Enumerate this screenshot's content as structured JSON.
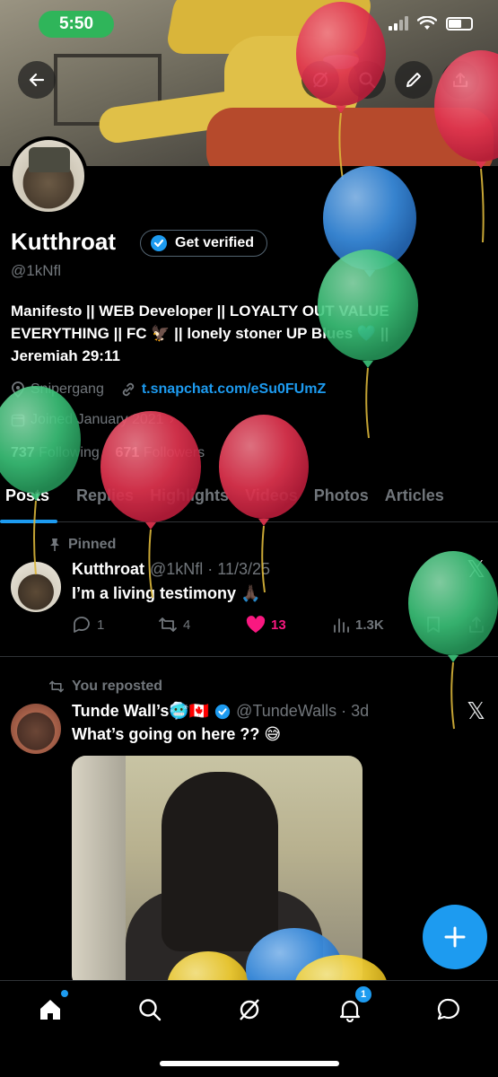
{
  "status_bar": {
    "time": "5:50"
  },
  "profile": {
    "name": "Kutthroat",
    "get_verified_label": "Get verified",
    "handle": "@1kNfl",
    "bio_line1": "Manifesto || WEB Developer || LOYALTY OUT VALUE",
    "bio_line2": "EVERYTHING || FC 🦅 || lonely stoner UP Blues 💙 ||",
    "bio_line3": "Jeremiah 29:11",
    "location": "Snipergang",
    "link": "t.snapchat.com/eSu0FUmZ",
    "joined": "Joined January 2021",
    "following_count": "737",
    "following_label": "Following",
    "followers_count": "671",
    "followers_label": "Followers"
  },
  "tabs": [
    "Posts",
    "Replies",
    "Highlights",
    "Videos",
    "Photos",
    "Articles"
  ],
  "pinned_post": {
    "context": "Pinned",
    "author": "Kutthroat",
    "handle_time": "@1kNfl · 11/3/25",
    "text": "I’m a living testimony 🙏🏿",
    "replies": "1",
    "reposts": "4",
    "likes": "13",
    "views": "1.3K"
  },
  "repost": {
    "context": "You reposted",
    "author": "Tunde Wall’s🥶🇨🇦",
    "handle_time": "@TundeWalls · 3d",
    "text": "What’s going on here ?? 😅"
  },
  "tabbar": {
    "notifications_badge": "1"
  },
  "icons": [
    "back-arrow-icon",
    "grok-icon",
    "search-icon",
    "edit-icon",
    "share-icon",
    "verified-badge-icon",
    "location-icon",
    "link-icon",
    "calendar-icon",
    "pin-icon",
    "reply-icon",
    "repost-icon",
    "heart-icon",
    "views-icon",
    "bookmark-icon",
    "x-logo-icon",
    "plus-icon",
    "home-icon",
    "bell-icon",
    "messages-icon"
  ],
  "colors": {
    "accent": "#1d9bf0",
    "like": "#f91880",
    "status_pill": "#2fb55a",
    "background": "#000000"
  }
}
